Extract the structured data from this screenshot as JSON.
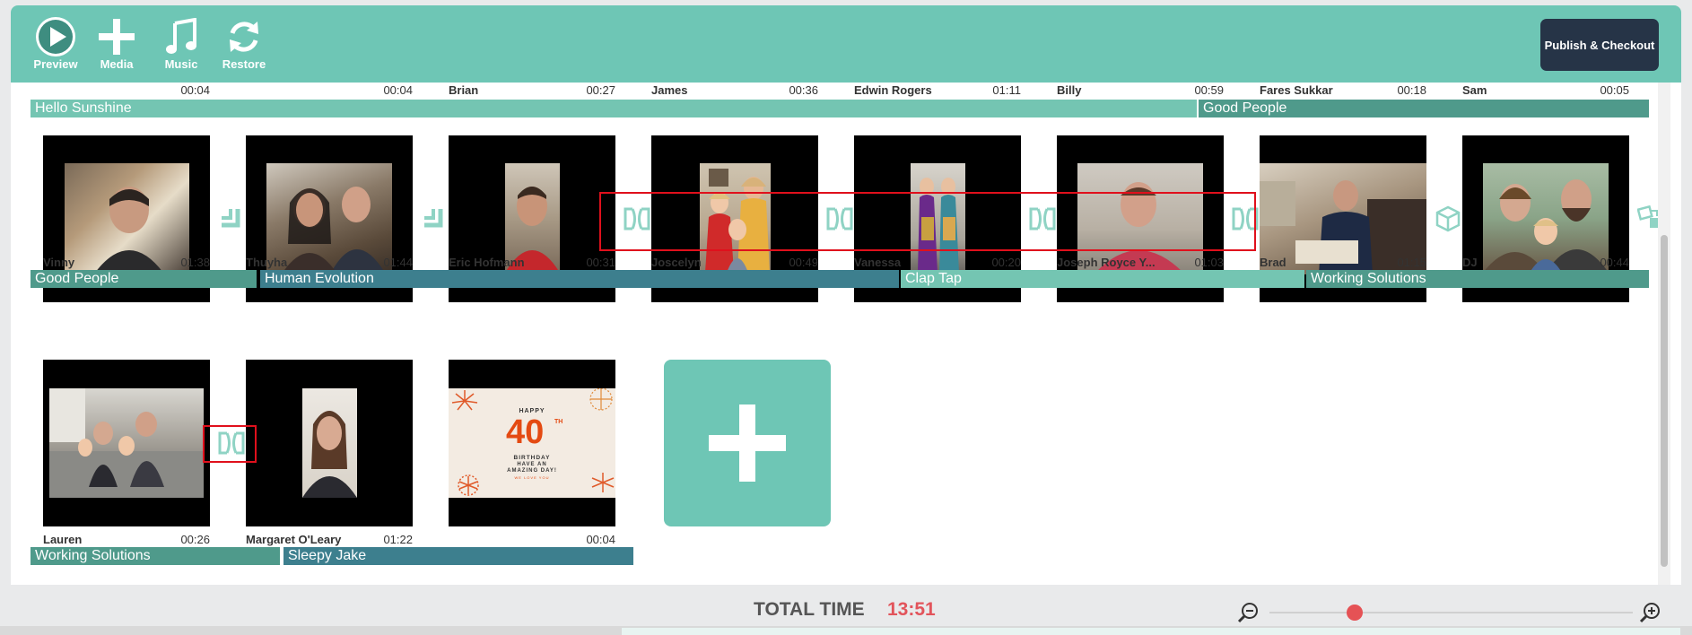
{
  "toolbar": {
    "preview": "Preview",
    "media": "Media",
    "music": "Music",
    "restore": "Restore",
    "publish": "Publish & Checkout"
  },
  "row0": {
    "clips": [
      {
        "name": "",
        "time": "00:04"
      },
      {
        "name": "",
        "time": "00:04"
      },
      {
        "name": "Brian",
        "time": "00:27"
      },
      {
        "name": "James",
        "time": "00:36"
      },
      {
        "name": "Edwin Rogers",
        "time": "01:11"
      },
      {
        "name": "Billy",
        "time": "00:59"
      },
      {
        "name": "Fares Sukkar",
        "time": "00:18"
      },
      {
        "name": "Sam",
        "time": "00:05"
      }
    ],
    "songs": [
      "Hello Sunshine",
      "Good People"
    ]
  },
  "row1": {
    "clips": [
      {
        "name": "Vinny",
        "time": "01:38"
      },
      {
        "name": "Thuyha",
        "time": "01:44"
      },
      {
        "name": "Eric Hofmann",
        "time": "00:31"
      },
      {
        "name": "Joscelyn",
        "time": "00:49"
      },
      {
        "name": "Vanessa",
        "time": "00:20"
      },
      {
        "name": "Joseph Royce Y...",
        "time": "01:03"
      },
      {
        "name": "Brad",
        "time": "01:15"
      },
      {
        "name": "DJ",
        "time": "00:44"
      }
    ],
    "songs": [
      "Good People",
      "Human Evolution",
      "Clap Tap",
      "Working Solutions"
    ]
  },
  "row2": {
    "clips": [
      {
        "name": "Lauren",
        "time": "00:26"
      },
      {
        "name": "Margaret O'Leary",
        "time": "01:22"
      },
      {
        "name": "",
        "time": "00:04"
      }
    ],
    "songs": [
      "Working Solutions",
      "Sleepy Jake"
    ]
  },
  "card": {
    "happy": "HAPPY",
    "number": "40",
    "sup": "TH",
    "line1": "BIRTHDAY",
    "line2": "HAVE AN",
    "line3": "AMAZING DAY!",
    "line4": "WE LOVE YOU"
  },
  "footer": {
    "total_label": "TOTAL TIME",
    "total_value": "13:51",
    "zoom_level": 0.2
  },
  "colors": {
    "accent": "#6ec6b5",
    "publish_bg": "#263447",
    "total_value": "#e2545b",
    "selection": "#e0101c"
  }
}
